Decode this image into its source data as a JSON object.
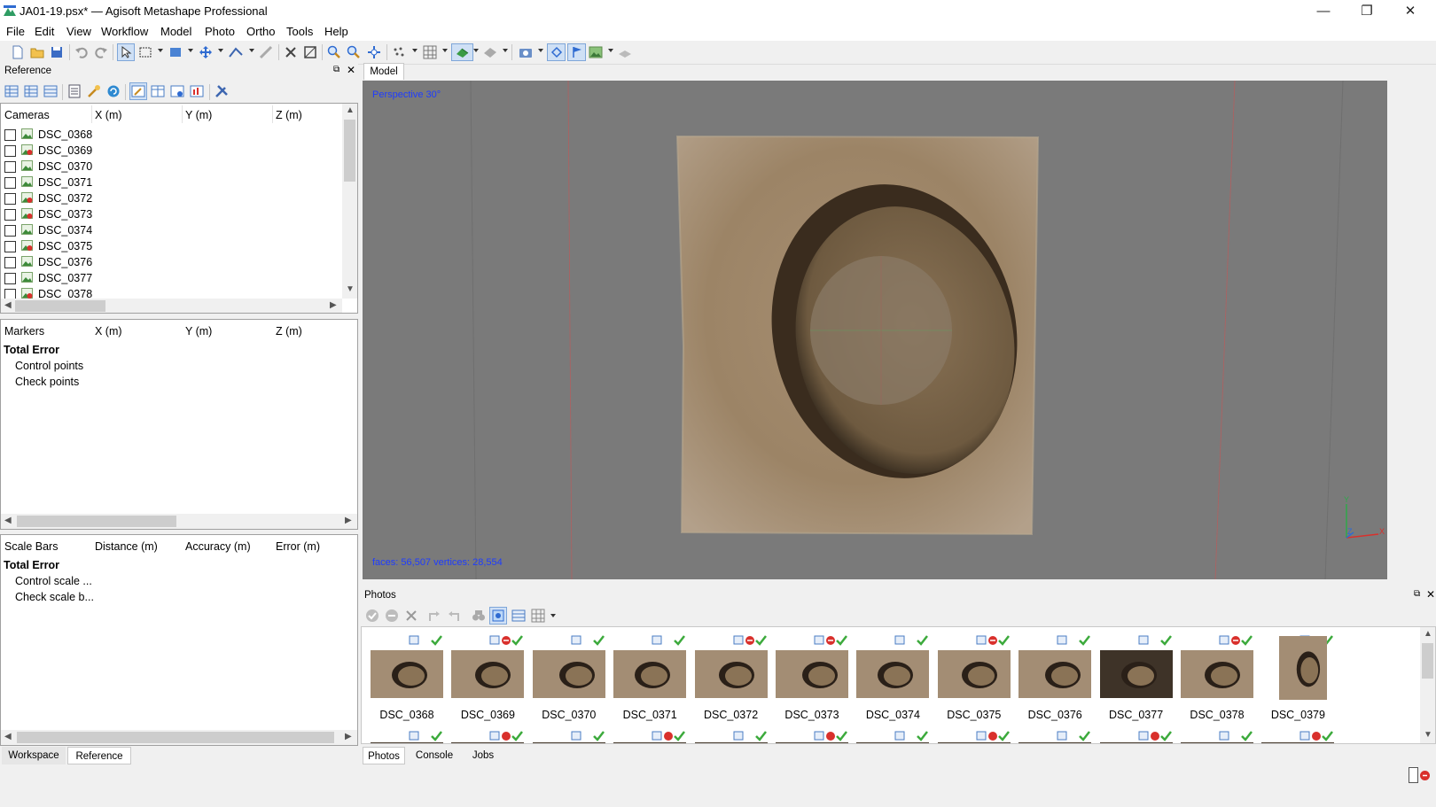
{
  "window": {
    "title": "JA01-19.psx* — Agisoft Metashape Professional",
    "controls": {
      "minimize": "—",
      "maximize": "❐",
      "close": "✕"
    }
  },
  "menu": [
    "File",
    "Edit",
    "View",
    "Workflow",
    "Model",
    "Photo",
    "Ortho",
    "Tools",
    "Help"
  ],
  "reference_panel": {
    "title": "Reference",
    "cameras": {
      "headers": [
        "Cameras",
        "X (m)",
        "Y (m)",
        "Z (m)"
      ],
      "rows": [
        {
          "label": "DSC_0368",
          "flag": "green"
        },
        {
          "label": "DSC_0369",
          "flag": "red"
        },
        {
          "label": "DSC_0370",
          "flag": "green"
        },
        {
          "label": "DSC_0371",
          "flag": "green"
        },
        {
          "label": "DSC_0372",
          "flag": "red"
        },
        {
          "label": "DSC_0373",
          "flag": "red"
        },
        {
          "label": "DSC_0374",
          "flag": "green"
        },
        {
          "label": "DSC_0375",
          "flag": "red"
        },
        {
          "label": "DSC_0376",
          "flag": "green"
        },
        {
          "label": "DSC_0377",
          "flag": "green"
        },
        {
          "label": "DSC_0378",
          "flag": "red"
        }
      ]
    },
    "markers": {
      "headers": [
        "Markers",
        "X (m)",
        "Y (m)",
        "Z (m)"
      ],
      "total": "Total Error",
      "items": [
        "Control points",
        "Check points"
      ]
    },
    "scalebars": {
      "headers": [
        "Scale Bars",
        "Distance (m)",
        "Accuracy (m)",
        "Error (m)"
      ],
      "total": "Total Error",
      "items": [
        "Control scale ...",
        "Check scale b..."
      ]
    }
  },
  "left_tabs": [
    "Workspace",
    "Reference"
  ],
  "model": {
    "tab": "Model",
    "view_label": "Perspective 30°",
    "stats": "faces: 56,507 vertices: 28,554",
    "axes": {
      "y": "Y",
      "x": "X",
      "z": "Z"
    }
  },
  "photos_panel": {
    "title": "Photos",
    "items": [
      {
        "label": "DSC_0368",
        "status": "ok"
      },
      {
        "label": "DSC_0369",
        "status": "red"
      },
      {
        "label": "DSC_0370",
        "status": "ok"
      },
      {
        "label": "DSC_0371",
        "status": "ok"
      },
      {
        "label": "DSC_0372",
        "status": "red"
      },
      {
        "label": "DSC_0373",
        "status": "red"
      },
      {
        "label": "DSC_0374",
        "status": "ok"
      },
      {
        "label": "DSC_0375",
        "status": "red"
      },
      {
        "label": "DSC_0376",
        "status": "ok"
      },
      {
        "label": "DSC_0377",
        "status": "ok"
      },
      {
        "label": "DSC_0378",
        "status": "red"
      },
      {
        "label": "DSC_0379",
        "status": "red"
      }
    ]
  },
  "bottom_tabs": [
    "Photos",
    "Console",
    "Jobs"
  ],
  "colors": {
    "accent": "#2a5fd0",
    "viewport_bg": "#7a7a7a",
    "ok_green": "#3caa3c",
    "error_red": "#d9302c"
  }
}
